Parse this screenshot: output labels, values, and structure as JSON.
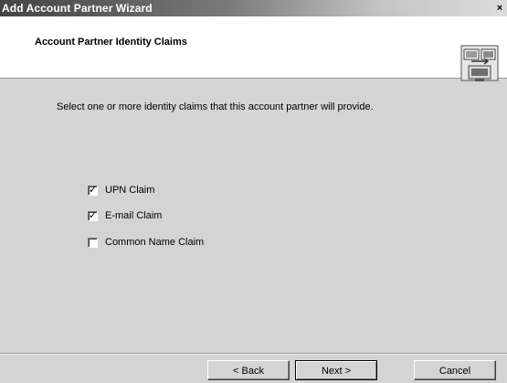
{
  "window": {
    "title": "Add Account Partner Wizard",
    "close_glyph": "×"
  },
  "header": {
    "title": "Account Partner Identity Claims",
    "icon": "wizard-computer-icon"
  },
  "body": {
    "instructions": "Select one or more identity claims that this account partner will provide.",
    "claims": [
      {
        "label": "UPN Claim",
        "checked": true
      },
      {
        "label": "E-mail Claim",
        "checked": true
      },
      {
        "label": "Common Name Claim",
        "checked": false
      }
    ],
    "check_glyph": "✓"
  },
  "buttons": {
    "back": "< Back",
    "next": "Next >",
    "cancel": "Cancel"
  }
}
